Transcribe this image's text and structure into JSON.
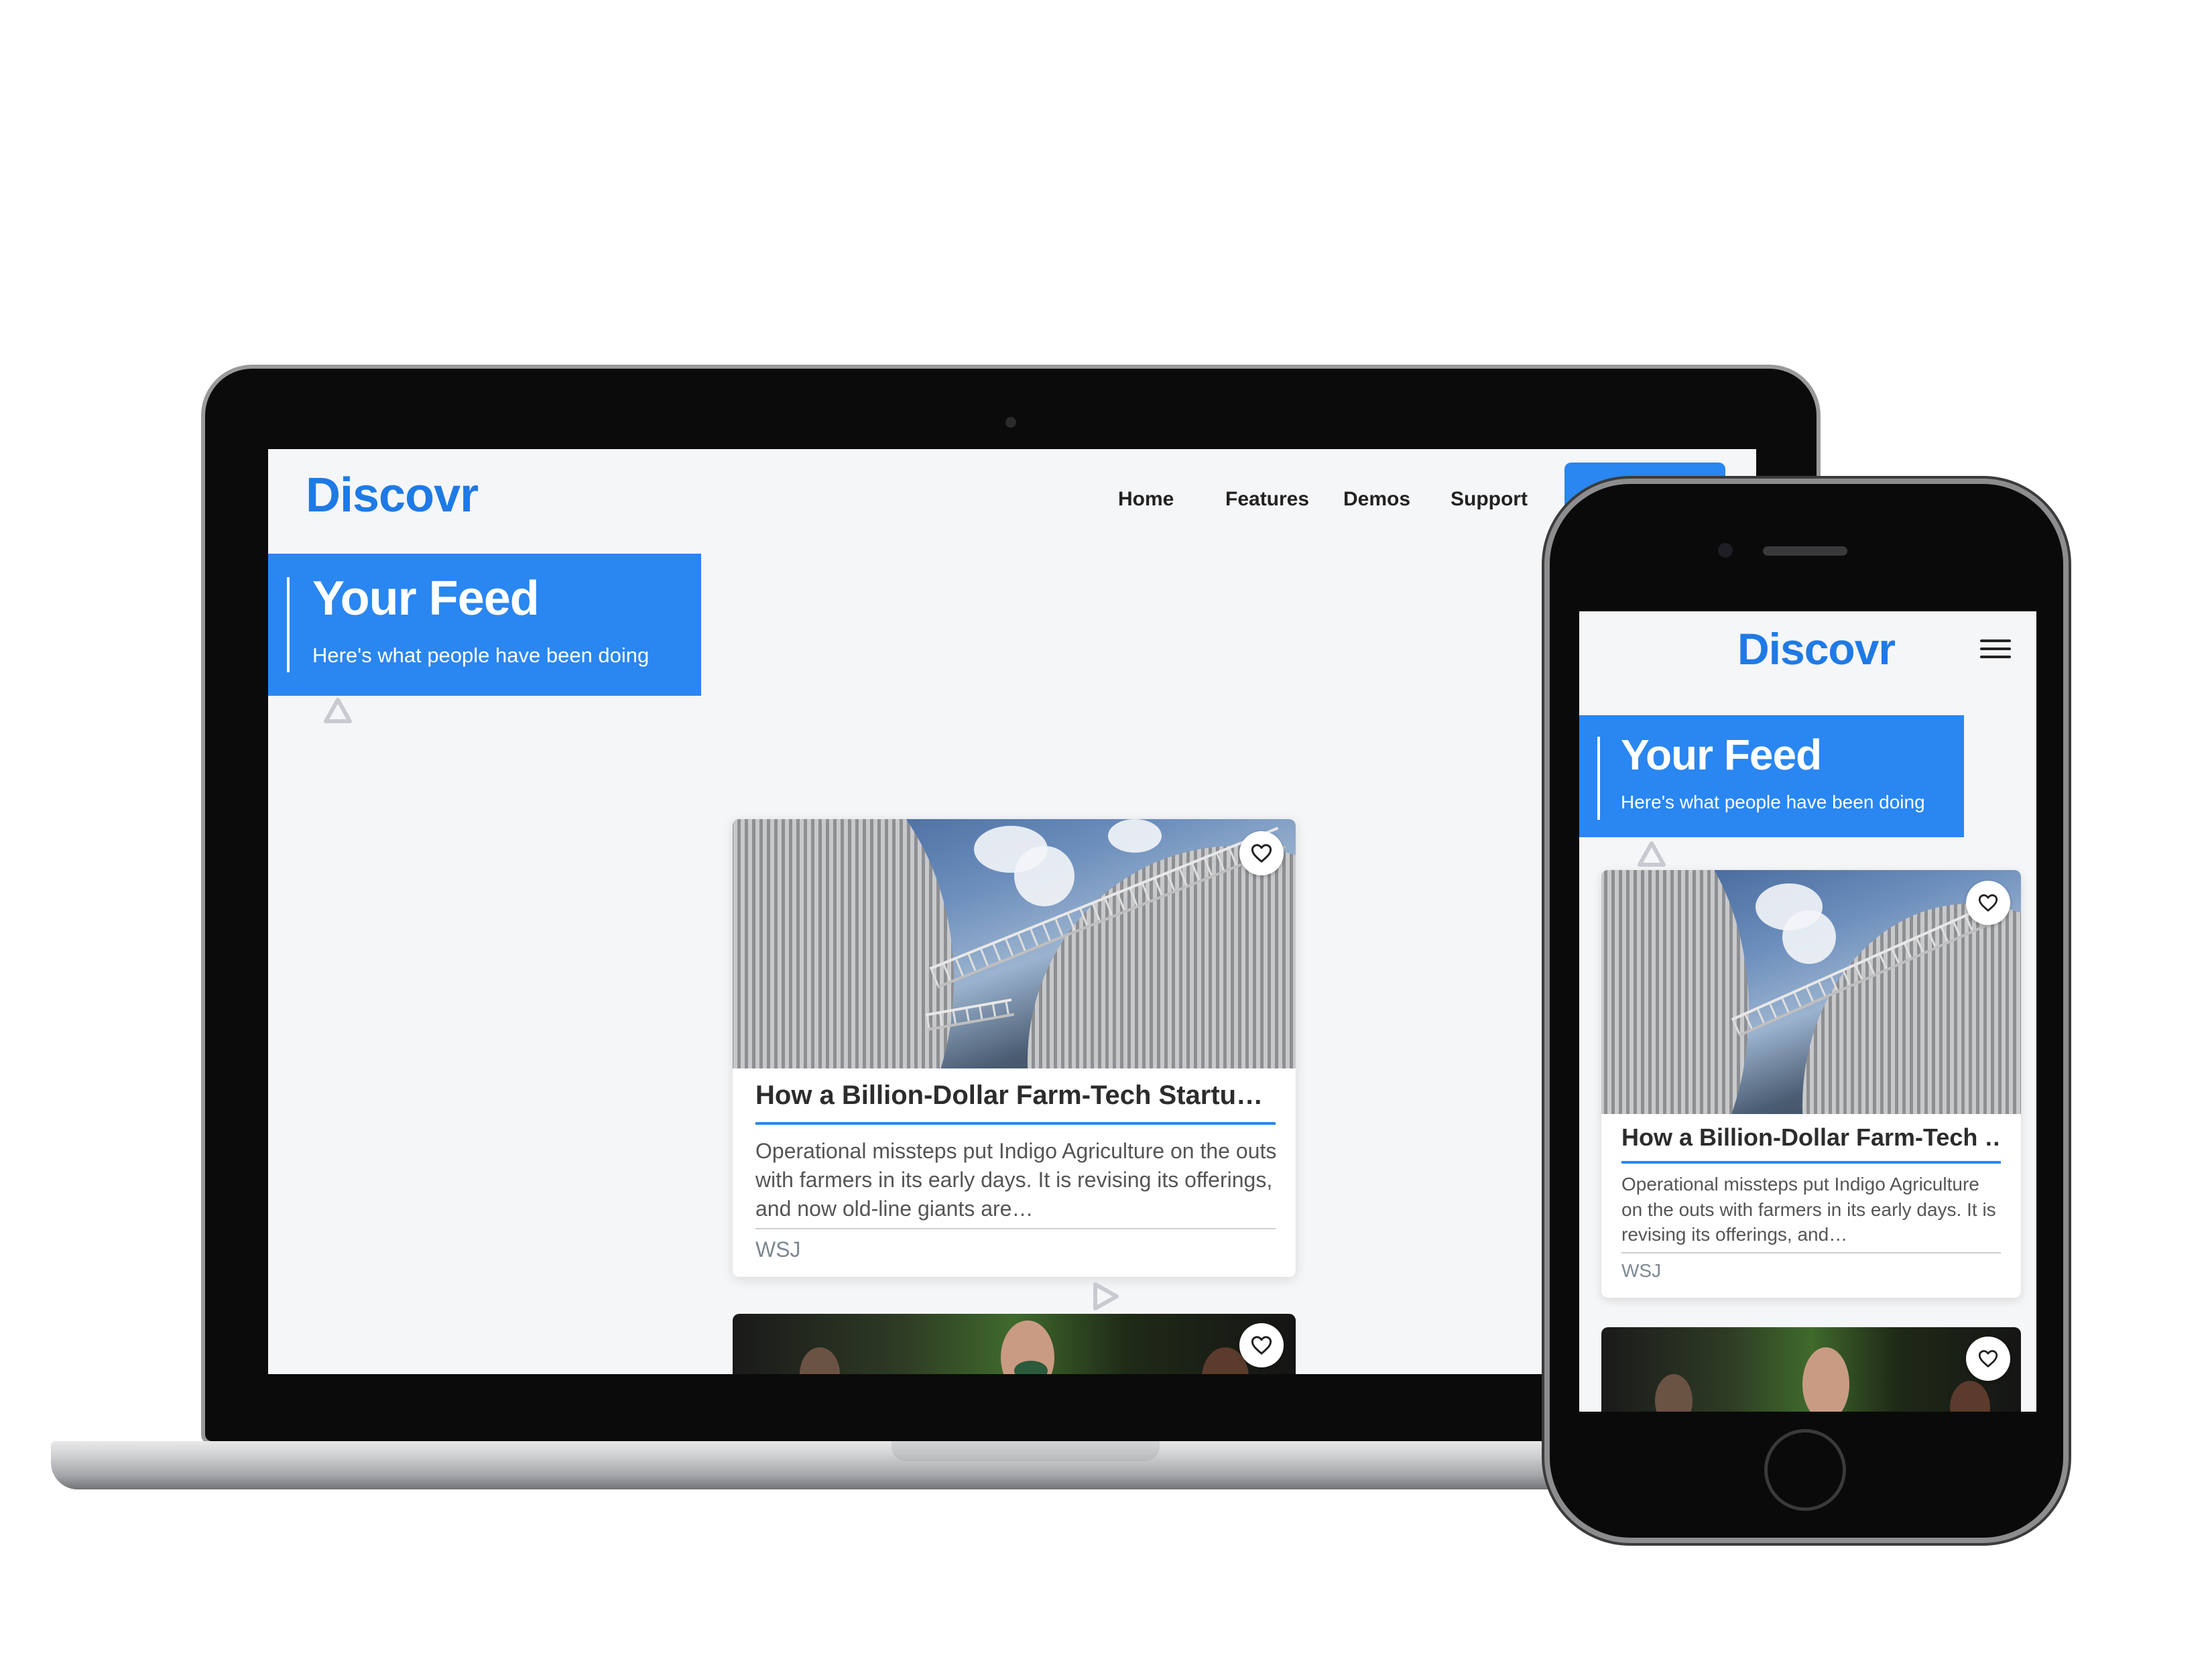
{
  "brand": {
    "logo_text": "Discovr",
    "accent_color": "#2a86f0",
    "logo_color": "#1f7ae6"
  },
  "desktop": {
    "nav": {
      "home": "Home",
      "features": "Features",
      "demos": "Demos",
      "support": "Support"
    },
    "hero": {
      "title": "Your Feed",
      "subtitle": "Here's what people have been doing"
    },
    "card": {
      "title": "How a Billion-Dollar Farm-Tech Startu…",
      "description": "Operational missteps put Indigo Agriculture on the outs with farmers in its early days. It is revising its offerings, and now old-line giants are…",
      "source": "WSJ",
      "favorite_icon": "heart-icon"
    }
  },
  "mobile": {
    "menu_icon": "hamburger-menu-icon",
    "hero": {
      "title": "Your Feed",
      "subtitle": "Here's what people have been doing"
    },
    "card": {
      "title": "How a Billion-Dollar Farm-Tech …",
      "description": "Operational missteps put Indigo Agriculture on the outs with farmers in its early days. It is revising its offerings, and…",
      "source": "WSJ",
      "favorite_icon": "heart-icon"
    }
  }
}
